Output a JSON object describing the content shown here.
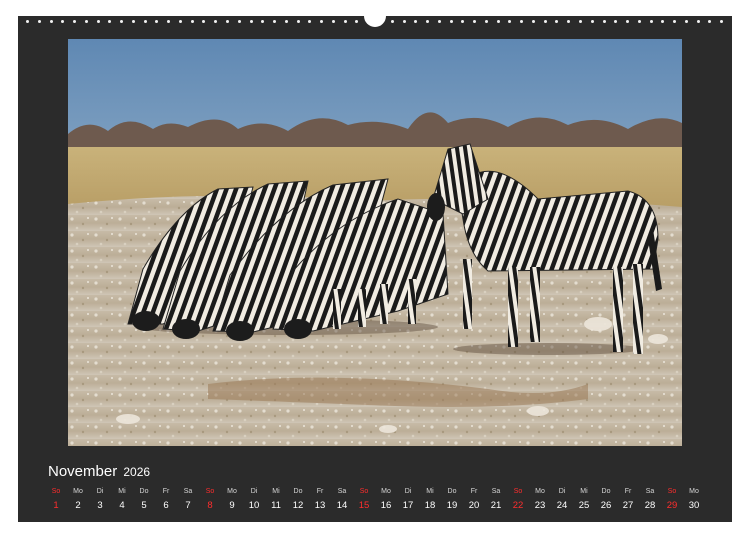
{
  "calendar": {
    "month": "November",
    "year": "2026",
    "sunday_color": "#ff2d2d",
    "days": [
      {
        "name": "So",
        "date": "1",
        "sunday": true
      },
      {
        "name": "Mo",
        "date": "2"
      },
      {
        "name": "Di",
        "date": "3"
      },
      {
        "name": "Mi",
        "date": "4"
      },
      {
        "name": "Do",
        "date": "5"
      },
      {
        "name": "Fr",
        "date": "6"
      },
      {
        "name": "Sa",
        "date": "7"
      },
      {
        "name": "So",
        "date": "8",
        "sunday": true
      },
      {
        "name": "Mo",
        "date": "9"
      },
      {
        "name": "Di",
        "date": "10"
      },
      {
        "name": "Mi",
        "date": "11"
      },
      {
        "name": "Do",
        "date": "12"
      },
      {
        "name": "Fr",
        "date": "13"
      },
      {
        "name": "Sa",
        "date": "14"
      },
      {
        "name": "So",
        "date": "15",
        "sunday": true
      },
      {
        "name": "Mo",
        "date": "16"
      },
      {
        "name": "Di",
        "date": "17"
      },
      {
        "name": "Mi",
        "date": "18"
      },
      {
        "name": "Do",
        "date": "19"
      },
      {
        "name": "Fr",
        "date": "20"
      },
      {
        "name": "Sa",
        "date": "21"
      },
      {
        "name": "So",
        "date": "22",
        "sunday": true
      },
      {
        "name": "Mo",
        "date": "23"
      },
      {
        "name": "Di",
        "date": "24"
      },
      {
        "name": "Mi",
        "date": "25"
      },
      {
        "name": "Do",
        "date": "26"
      },
      {
        "name": "Fr",
        "date": "27"
      },
      {
        "name": "Sa",
        "date": "28"
      },
      {
        "name": "So",
        "date": "29",
        "sunday": true
      },
      {
        "name": "Mo",
        "date": "30"
      }
    ]
  }
}
